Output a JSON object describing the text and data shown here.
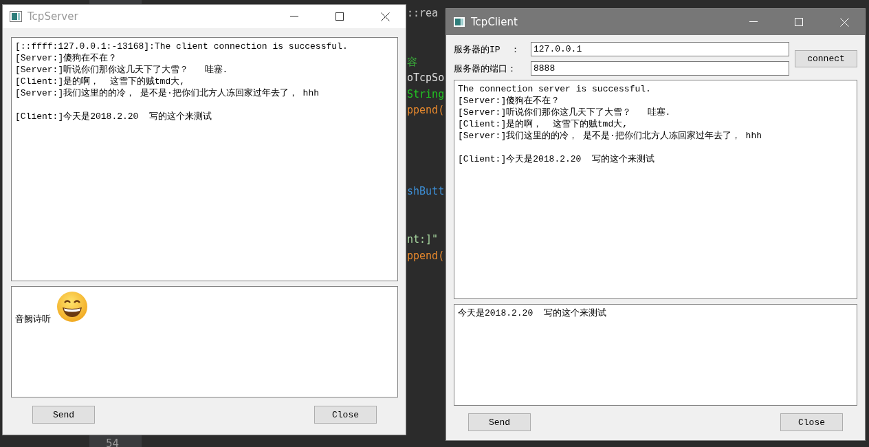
{
  "editor": {
    "code_lines": [
      {
        "kind": "code",
        "text": "::rea",
        "color": "#c8c8c8"
      },
      {
        "kind": "blank"
      },
      {
        "kind": "blank"
      },
      {
        "kind": "code",
        "text": "容",
        "color": "#3cb83c"
      },
      {
        "kind": "code",
        "text": "oTcpSo",
        "color": "#e0e0e0"
      },
      {
        "kind": "code",
        "text": "String",
        "color": "#22c422"
      },
      {
        "kind": "code",
        "text": "ppend(",
        "color": "#e8892d"
      },
      {
        "kind": "blank"
      },
      {
        "kind": "blank"
      },
      {
        "kind": "blank"
      },
      {
        "kind": "blank"
      },
      {
        "kind": "code",
        "text": "shButt",
        "color": "#3d8fd6"
      },
      {
        "kind": "blank"
      },
      {
        "kind": "blank"
      },
      {
        "kind": "code",
        "text": "nt:]\"",
        "color": "#a8d8a0"
      },
      {
        "kind": "code",
        "text": "ppend(",
        "color": "#e8892d"
      }
    ],
    "line_number": "54"
  },
  "server": {
    "title": "TcpServer",
    "active": false,
    "log": [
      {
        "kind": "line",
        "text": "[::ffff:127.0.0.1:-13168]:The client connection is successful."
      },
      {
        "kind": "line",
        "text": "[Server:]傻狗在不在？"
      },
      {
        "kind": "line",
        "text": "[Server:]听说你们那你这几天下了大雪？   哇塞."
      },
      {
        "kind": "line",
        "text": "[Client:]是的啊，  这雪下的贼tmd大,"
      },
      {
        "kind": "line",
        "text": "[Server:]我们这里的的冷， 是不是·把你们北方人冻回家过年去了， hhh"
      },
      {
        "kind": "blank"
      },
      {
        "kind": "line",
        "text": "[Client:]今天是2018.2.20  写的这个来测试"
      }
    ],
    "input": [
      {
        "kind": "text",
        "text": "音阙诗听"
      },
      {
        "kind": "emoji"
      }
    ],
    "buttons": [
      "Send",
      "Close"
    ]
  },
  "client": {
    "title": "TcpClient",
    "active": true,
    "fields": [
      {
        "label": "服务器的IP  ：",
        "value": "127.0.0.1"
      },
      {
        "label": "服务器的端口：",
        "value": "8888"
      }
    ],
    "connect_button": "connect",
    "log": [
      {
        "kind": "line",
        "text": "The connection server is successful."
      },
      {
        "kind": "line",
        "text": "[Server:]傻狗在不在？"
      },
      {
        "kind": "line",
        "text": "[Server:]听说你们那你这几天下了大雪？   哇塞."
      },
      {
        "kind": "line",
        "text": "[Client:]是的啊，  这雪下的贼tmd大,"
      },
      {
        "kind": "line",
        "text": "[Server:]我们这里的的冷， 是不是·把你们北方人冻回家过年去了， hhh"
      },
      {
        "kind": "blank"
      },
      {
        "kind": "line",
        "text": "[Client:]今天是2018.2.20  写的这个来测试"
      }
    ],
    "input": [
      {
        "kind": "text",
        "text": "今天是2018.2.20  写的这个来测试"
      }
    ],
    "buttons": [
      "Send",
      "Close"
    ]
  }
}
